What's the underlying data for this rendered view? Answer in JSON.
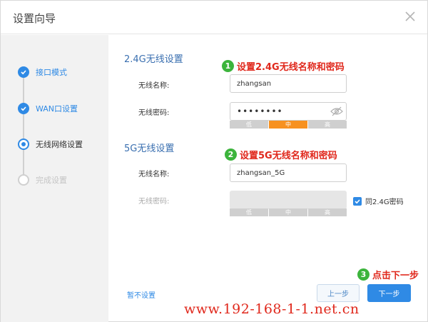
{
  "dialog": {
    "title": "设置向导"
  },
  "steps": [
    {
      "label": "接口模式",
      "state": "done"
    },
    {
      "label": "WAN口设置",
      "state": "done"
    },
    {
      "label": "无线网络设置",
      "state": "active"
    },
    {
      "label": "完成设置",
      "state": "pending"
    }
  ],
  "wifi24": {
    "section_title": "2.4G无线设置",
    "name_label": "无线名称:",
    "name_value": "zhangsan",
    "password_label": "无线密码:",
    "password_value": "••••••••",
    "strength": {
      "low": "低",
      "mid": "中",
      "high": "高",
      "level": "中"
    }
  },
  "wifi5": {
    "section_title": "5G无线设置",
    "name_label": "无线名称:",
    "name_value": "zhangsan_5G",
    "password_label": "无线密码:",
    "strength": {
      "low": "低",
      "mid": "中",
      "high": "高"
    },
    "same_as_24_label": "同2.4G密码",
    "same_as_24_checked": true
  },
  "annotations": [
    {
      "num": "1",
      "text": "设置2.4G无线名称和密码"
    },
    {
      "num": "2",
      "text": "设置5G无线名称和密码"
    },
    {
      "num": "3",
      "text": "点击下一步"
    }
  ],
  "footer": {
    "skip_label": "暂不设置",
    "prev_label": "上一步",
    "next_label": "下一步"
  },
  "watermark": "www.192-168-1-1.net.cn",
  "colors": {
    "accent": "#2f8ae5",
    "annotation_red": "#e0281c",
    "annotation_green": "#3cb43c",
    "strength_mid": "#f79120"
  }
}
